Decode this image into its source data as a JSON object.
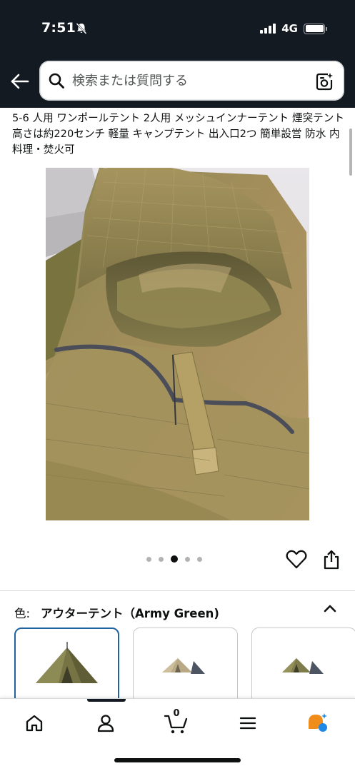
{
  "status_bar": {
    "time": "7:51",
    "network": "4G"
  },
  "header": {
    "search_placeholder": "検索または質問する"
  },
  "product": {
    "title": "5-6 人用 ワンポールテント 2人用 メッシュインナーテント 煙突テント 高さは約220センチ 軽量 キャンプテント 出入口2つ 簡単設営 防水 内料理・焚火可",
    "image_count": 5,
    "active_image_index": 2
  },
  "variant": {
    "label": "色:",
    "value": "アウターテント（Army Green)",
    "selected_swatch_index": 0
  },
  "bottom_nav": {
    "cart_count": "0"
  },
  "colors": {
    "header_bg": "#131a22",
    "selected_border": "#2162a1",
    "tent_green": "#7d7a4c"
  }
}
